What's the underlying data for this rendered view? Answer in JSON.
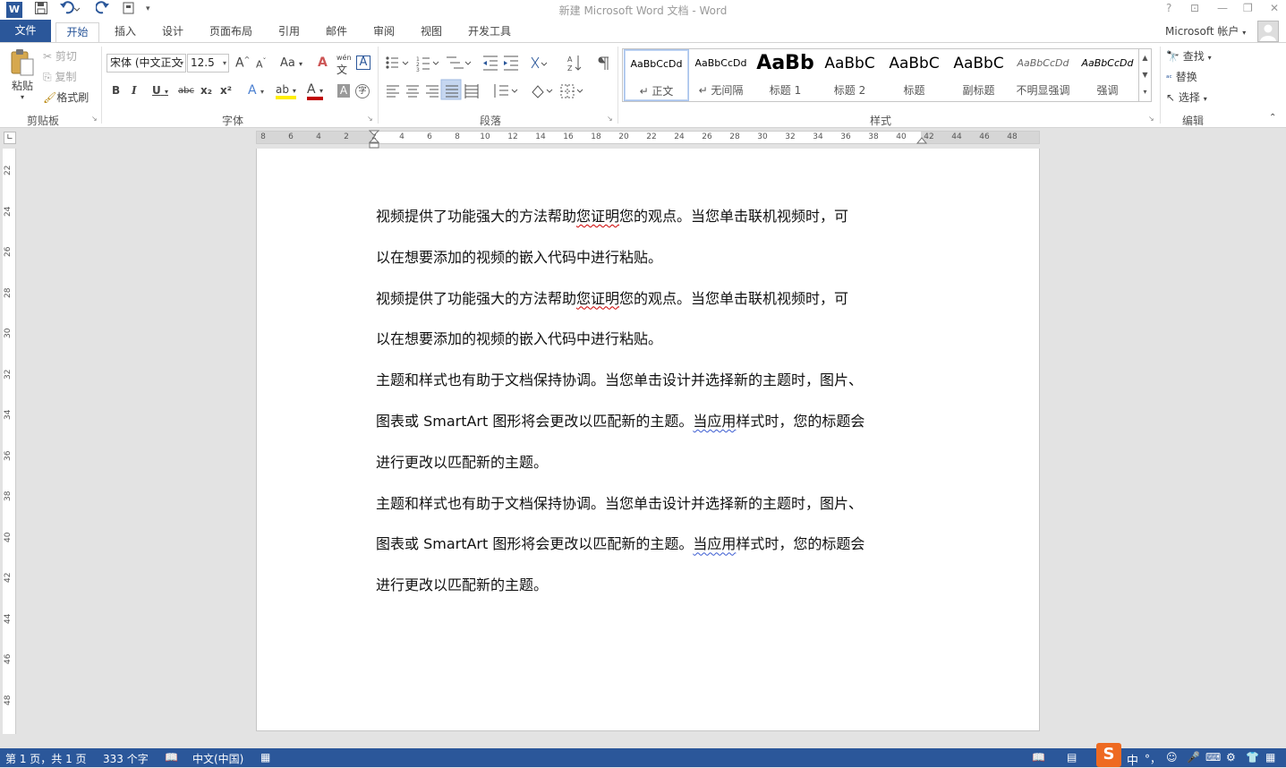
{
  "title_bar": {
    "title": "新建 Microsoft Word 文档 - Word",
    "help": "?",
    "restore_ribbon": "⊡",
    "minimize": "—",
    "maximize": "❐",
    "close": "✕"
  },
  "tabs": [
    {
      "label": "文件"
    },
    {
      "label": "开始"
    },
    {
      "label": "插入"
    },
    {
      "label": "设计"
    },
    {
      "label": "页面布局"
    },
    {
      "label": "引用"
    },
    {
      "label": "邮件"
    },
    {
      "label": "审阅"
    },
    {
      "label": "视图"
    },
    {
      "label": "开发工具"
    }
  ],
  "account": "Microsoft 帐户",
  "ribbon": {
    "clipboard": {
      "paste": "粘贴",
      "cut": "剪切",
      "copy": "复制",
      "format_painter": "格式刷",
      "group_label": "剪贴板"
    },
    "font": {
      "font_name": "宋体 (中文正文",
      "font_size": "12.5",
      "group_label": "字体",
      "change_case": "Aa",
      "phonetic": "wén",
      "bold": "B",
      "italic": "I",
      "underline": "U",
      "strikethrough": "abc",
      "subscript": "x₂",
      "superscript": "x²",
      "grow": "A",
      "shrink": "A",
      "clear": "A",
      "text_effects": "A",
      "highlight": "ab",
      "font_color": "A",
      "shading": "A",
      "enclose": "字"
    },
    "paragraph": {
      "group_label": "段落"
    },
    "styles": {
      "group_label": "样式",
      "items": [
        {
          "preview": "AaBbCcDd",
          "name": "↵ 正文"
        },
        {
          "preview": "AaBbCcDd",
          "name": "↵ 无间隔"
        },
        {
          "preview": "AaBb",
          "name": "标题 1"
        },
        {
          "preview": "AaBbC",
          "name": "标题 2"
        },
        {
          "preview": "AaBbC",
          "name": "标题"
        },
        {
          "preview": "AaBbC",
          "name": "副标题"
        },
        {
          "preview": "AaBbCcDd",
          "name": "不明显强调"
        },
        {
          "preview": "AaBbCcDd",
          "name": "强调"
        }
      ]
    },
    "editing": {
      "find": "查找",
      "replace": "替换",
      "select": "选择",
      "group_label": "编辑"
    }
  },
  "ruler": {
    "h_ticks": [
      "8",
      "6",
      "4",
      "2",
      "2",
      "4",
      "6",
      "8",
      "10",
      "12",
      "14",
      "16",
      "18",
      "20",
      "22",
      "24",
      "26",
      "28",
      "30",
      "32",
      "34",
      "36",
      "38",
      "40",
      "42",
      "44",
      "46",
      "48"
    ],
    "v_ticks": [
      "22",
      "24",
      "26",
      "28",
      "30",
      "32",
      "34",
      "36",
      "38",
      "40",
      "42",
      "44",
      "46",
      "48"
    ]
  },
  "document": {
    "lines": [
      {
        "pre": "视频提供了功能强大的方法帮助",
        "err": "您证明",
        "post": "您的观点。当您单击联机视频时，可",
        "style": "red"
      },
      {
        "pre": "以在想要添加的视频的嵌入代码中进行粘贴。",
        "err": "",
        "post": "",
        "style": "red"
      },
      {
        "pre": "视频提供了功能强大的方法帮助",
        "err": "您证明",
        "post": "您的观点。当您单击联机视频时，可",
        "style": "red"
      },
      {
        "pre": "以在想要添加的视频的嵌入代码中进行粘贴。",
        "err": "",
        "post": "",
        "style": "red"
      },
      {
        "pre": "主题和样式也有助于文档保持协调。当您单击设计并选择新的主题时，图片、",
        "err": "",
        "post": "",
        "style": "red"
      },
      {
        "pre": "图表或 SmartArt 图形将会更改以匹配新的主题。",
        "err": "当应用",
        "post": "样式时，您的标题会",
        "style": "blue"
      },
      {
        "pre": "进行更改以匹配新的主题。",
        "err": "",
        "post": "",
        "style": "red"
      },
      {
        "pre": "主题和样式也有助于文档保持协调。当您单击设计并选择新的主题时，图片、",
        "err": "",
        "post": "",
        "style": "red"
      },
      {
        "pre": "图表或 SmartArt 图形将会更改以匹配新的主题。",
        "err": "当应用",
        "post": "样式时，您的标题会",
        "style": "blue"
      },
      {
        "pre": "进行更改以匹配新的主题。",
        "err": "",
        "post": "",
        "style": "red"
      }
    ]
  },
  "status_bar": {
    "page": "第 1 页，共 1 页",
    "words": "333 个字",
    "language": "中文(中国)",
    "ime": "中",
    "ime_punct": "°，"
  }
}
